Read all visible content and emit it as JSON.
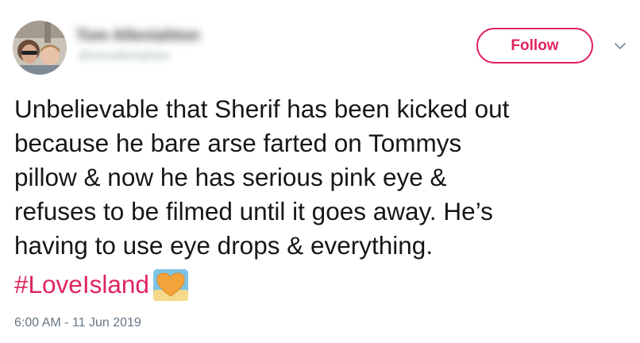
{
  "tweet": {
    "author_name": "Tom Allenighton",
    "author_handle": "@tomallenighton",
    "follow_label": "Follow",
    "text": "Unbelievable that Sherif has been kicked out\nbecause he bare arse farted on Tommys\npillow & now he has serious pink eye &\nrefuses to be filmed until it goes away. He’s\nhaving to use eye drops & everything.",
    "hashtag": "#LoveIsland",
    "timestamp": "6:00 AM - 11 Jun 2019"
  },
  "icons": {
    "avatar": "avatar-photo",
    "menu": "chevron-down-icon",
    "emoji": "orange-heart-emoji-icon"
  },
  "colors": {
    "accent": "#e0245e",
    "text": "#14171a",
    "secondary": "#657786"
  }
}
